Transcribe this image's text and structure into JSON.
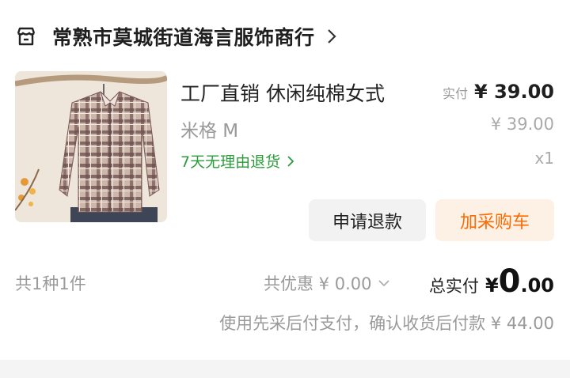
{
  "store": {
    "name": "常熟市莫城街道海言服饰商行",
    "icon": "store-icon",
    "chevron_icon": "chevron-right-icon"
  },
  "product": {
    "title": "工厂直销 休闲纯棉女式",
    "spec": "米格 M",
    "return_policy": "7天无理由退货",
    "paid_label": "实付",
    "paid_amount": "¥ 39.00",
    "original_price": "¥ 39.00",
    "quantity": "x1"
  },
  "actions": {
    "refund": "申请退款",
    "add_to_cart": "加采购车"
  },
  "summary": {
    "count": "共1种1件",
    "discount": "共优惠 ¥ 0.00",
    "total_label": "总实付",
    "total_currency": "¥",
    "total_integer": "0",
    "total_decimal": ".00",
    "pay_later_note": "使用先采后付支付，确认收货后付款 ¥ 44.00"
  },
  "colors": {
    "green": "#2b9c3a",
    "orange": "#ff6a00",
    "orange_bg": "#fdf1e6",
    "gray_btn": "#f2f2f2"
  }
}
